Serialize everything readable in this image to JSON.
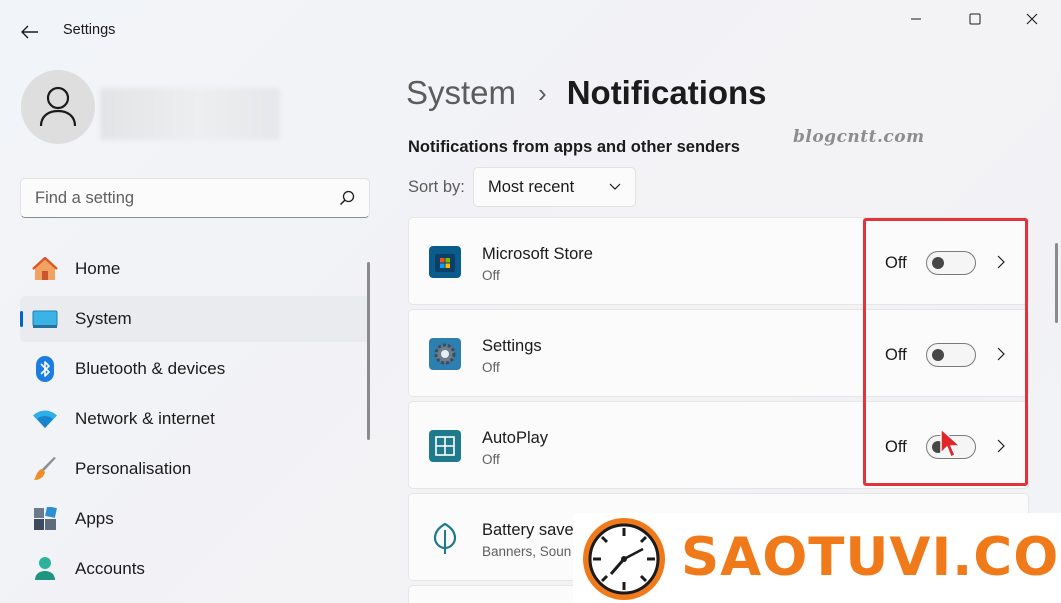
{
  "window": {
    "title": "Settings",
    "back_icon": "arrow-left-icon",
    "controls": [
      "minimize-icon",
      "maximize-icon",
      "close-icon"
    ]
  },
  "user": {
    "avatar_icon": "person-icon"
  },
  "search": {
    "placeholder": "Find a setting",
    "value": "",
    "icon": "search-icon"
  },
  "sidebar": {
    "items": [
      {
        "label": "Home",
        "icon": "home-icon",
        "active": false
      },
      {
        "label": "System",
        "icon": "monitor-icon",
        "active": true
      },
      {
        "label": "Bluetooth & devices",
        "icon": "bluetooth-icon",
        "active": false
      },
      {
        "label": "Network & internet",
        "icon": "wifi-icon",
        "active": false
      },
      {
        "label": "Personalisation",
        "icon": "paintbrush-icon",
        "active": false
      },
      {
        "label": "Apps",
        "icon": "apps-icon",
        "active": false
      },
      {
        "label": "Accounts",
        "icon": "account-icon",
        "active": false
      }
    ]
  },
  "breadcrumb": {
    "parent": "System",
    "separator": "›",
    "current": "Notifications"
  },
  "watermark_text": "blogcntt.com",
  "section": {
    "title": "Notifications from apps and other senders",
    "sort_label": "Sort by:",
    "sort_value": "Most recent"
  },
  "apps": [
    {
      "name": "Microsoft Store",
      "sub": "Off",
      "toggle_label": "Off",
      "enabled": false,
      "icon": "microsoft-store-icon"
    },
    {
      "name": "Settings",
      "sub": "Off",
      "toggle_label": "Off",
      "enabled": false,
      "icon": "settings-gear-icon"
    },
    {
      "name": "AutoPlay",
      "sub": "Off",
      "toggle_label": "Off",
      "enabled": false,
      "icon": "autoplay-icon"
    },
    {
      "name": "Battery save",
      "sub": "Banners, Soun",
      "icon": "battery-saver-icon"
    }
  ],
  "overlay_logo": {
    "text": "SAOTUVI.COM",
    "color": "#f07a1a"
  },
  "colors": {
    "accent": "#0067c0",
    "highlight": "#e0333a"
  }
}
